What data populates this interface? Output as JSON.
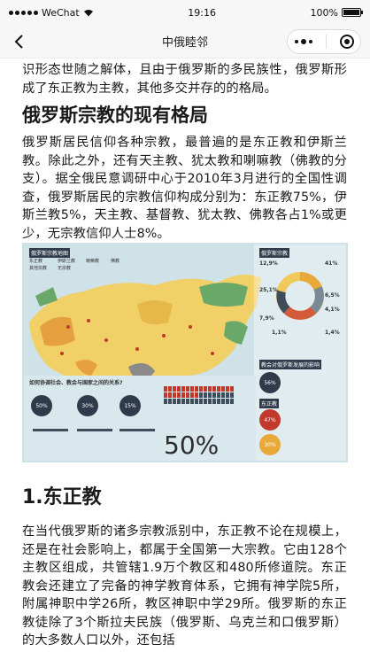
{
  "status_bar": {
    "carrier": "WeChat",
    "time": "19:16",
    "battery": "100%"
  },
  "nav": {
    "title": "中俄睦邻"
  },
  "article": {
    "intro_tail": "识形态世随之解体，且由于俄罗斯的多民族性，俄罗斯形成了东正教为主教，其他多交并存的的格局。",
    "section1_title": "俄罗斯宗教的现有格局",
    "section1_body": "俄罗斯居民信仰各种宗教，最普遍的是东正教和伊斯兰教。除此之外，还有天主教、犹太教和喇嘛教（佛教的分支）。据全俄民意调研中心于2010年3月进行的全国性调查，俄罗斯居民的宗教信仰构成分别为：东正教75%，伊斯兰教5%，天主教、基督教、犹太教、佛教各占1%或更少，无宗教信仰人士8%。",
    "section2_title": "1.东正教",
    "section2_body": "在当代俄罗斯的诸多宗教派别中，东正教不论在规模上，还是在社会影响上，都属于全国第一大宗教。它由128个主教区组成，共管辖1.9万个教区和480所修道院。东正教会还建立了完备的神学教育体系，它拥有神学院5所，附属神职中学26所，教区神职中学29所。俄罗斯的东正教徒除了3个斯拉夫民族（俄罗斯、乌克兰和口俄罗斯）的大多数人口以外，还包括"
  },
  "infographic": {
    "map_title": "俄罗斯宗教地图",
    "legend_items": [
      "东正教",
      "伊斯兰教",
      "喇嘛教",
      "佛教",
      "其他宗教",
      "无宗教"
    ],
    "donut_title": "俄罗斯宗教",
    "donut_pcts": [
      "12,9%",
      "41%",
      "25,1%",
      "6,5%",
      "4,1%",
      "7,9%",
      "1,1%",
      "1,4%"
    ],
    "donut_colors": [
      "#e8a93a",
      "#f0c95a",
      "#d35a3a",
      "#7a8a95",
      "#a3b7c2",
      "#3d4d5c",
      "#c9c9c9",
      "#5a9c6a"
    ],
    "relation_title": "如何协调社会、教会与国家之间的关系?",
    "relation_pcts": [
      "50%",
      "30%",
      "15%"
    ],
    "influence_title": "教会对俄罗斯发展的影响",
    "influence_pcts": [
      "56%"
    ],
    "orthodox_title": "东正教",
    "orthodox_pcts": [
      "47%",
      "30%"
    ],
    "big_percent": "50%"
  }
}
